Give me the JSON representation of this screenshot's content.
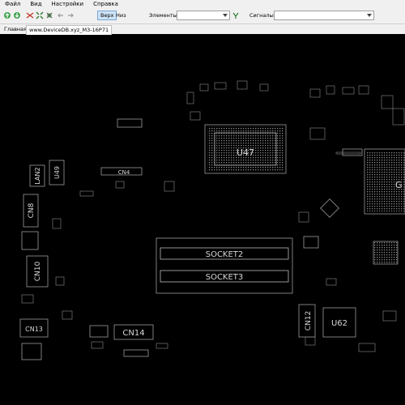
{
  "menu": [
    "Файл",
    "Вид",
    "Настройки",
    "Справка"
  ],
  "toolbar": {
    "btn_top": "Верх",
    "btn_bottom": "Низ",
    "elements_label": "Элементы:",
    "elements_value": "",
    "signals_label": "Сигналы:",
    "signals_value": ""
  },
  "tabs": [
    "Главная",
    "www.DeviceDB.xyz_M3-16P71"
  ],
  "board": {
    "labels": {
      "u47": "U47",
      "socket2": "SOCKET2",
      "socket3": "SOCKET3",
      "cn4": "CN4",
      "lan2": "LAN2",
      "u49": "U49",
      "cn8": "CN8",
      "cn10": "CN10",
      "cn13": "CN13",
      "cn14": "CN14",
      "cn12": "CN12",
      "u62": "U62",
      "g_partial": "G"
    }
  }
}
